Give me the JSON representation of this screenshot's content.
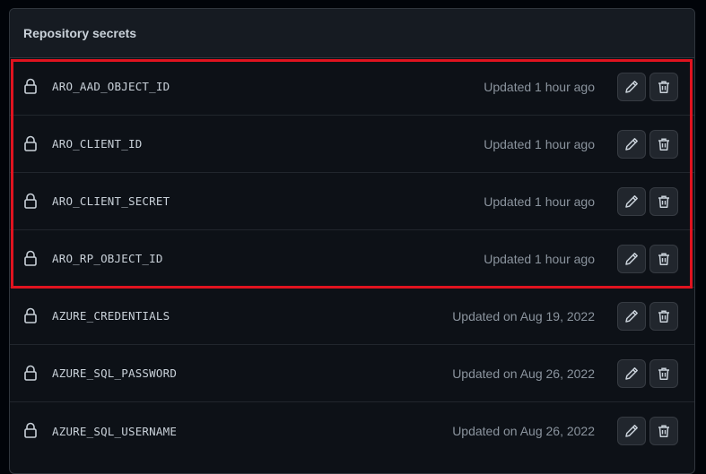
{
  "header": {
    "title": "Repository secrets"
  },
  "secrets": [
    {
      "name": "ARO_AAD_OBJECT_ID",
      "updated": "Updated 1 hour ago"
    },
    {
      "name": "ARO_CLIENT_ID",
      "updated": "Updated 1 hour ago"
    },
    {
      "name": "ARO_CLIENT_SECRET",
      "updated": "Updated 1 hour ago"
    },
    {
      "name": "ARO_RP_OBJECT_ID",
      "updated": "Updated 1 hour ago"
    },
    {
      "name": "AZURE_CREDENTIALS",
      "updated": "Updated on Aug 19, 2022"
    },
    {
      "name": "AZURE_SQL_PASSWORD",
      "updated": "Updated on Aug 26, 2022"
    },
    {
      "name": "AZURE_SQL_USERNAME",
      "updated": "Updated on Aug 26, 2022"
    }
  ],
  "icons": {
    "lock": "lock-icon",
    "edit": "pencil-icon",
    "delete": "trash-icon"
  },
  "colors": {
    "background": "#0d1117",
    "header": "#161b22",
    "text": "#c9d1d9",
    "muted": "#8b949e",
    "highlight": "#e0131f"
  }
}
